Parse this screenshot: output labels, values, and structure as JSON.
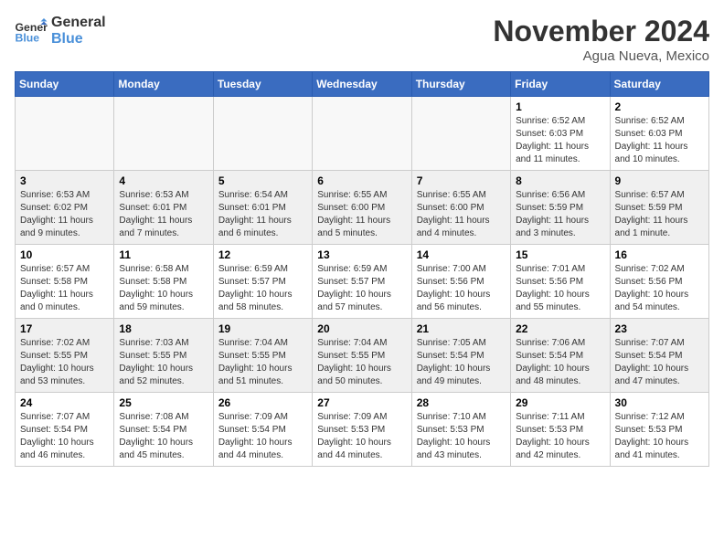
{
  "header": {
    "logo_line1": "General",
    "logo_line2": "Blue",
    "month": "November 2024",
    "location": "Agua Nueva, Mexico"
  },
  "weekdays": [
    "Sunday",
    "Monday",
    "Tuesday",
    "Wednesday",
    "Thursday",
    "Friday",
    "Saturday"
  ],
  "weeks": [
    [
      {
        "day": "",
        "info": ""
      },
      {
        "day": "",
        "info": ""
      },
      {
        "day": "",
        "info": ""
      },
      {
        "day": "",
        "info": ""
      },
      {
        "day": "",
        "info": ""
      },
      {
        "day": "1",
        "info": "Sunrise: 6:52 AM\nSunset: 6:03 PM\nDaylight: 11 hours\nand 11 minutes."
      },
      {
        "day": "2",
        "info": "Sunrise: 6:52 AM\nSunset: 6:03 PM\nDaylight: 11 hours\nand 10 minutes."
      }
    ],
    [
      {
        "day": "3",
        "info": "Sunrise: 6:53 AM\nSunset: 6:02 PM\nDaylight: 11 hours\nand 9 minutes."
      },
      {
        "day": "4",
        "info": "Sunrise: 6:53 AM\nSunset: 6:01 PM\nDaylight: 11 hours\nand 7 minutes."
      },
      {
        "day": "5",
        "info": "Sunrise: 6:54 AM\nSunset: 6:01 PM\nDaylight: 11 hours\nand 6 minutes."
      },
      {
        "day": "6",
        "info": "Sunrise: 6:55 AM\nSunset: 6:00 PM\nDaylight: 11 hours\nand 5 minutes."
      },
      {
        "day": "7",
        "info": "Sunrise: 6:55 AM\nSunset: 6:00 PM\nDaylight: 11 hours\nand 4 minutes."
      },
      {
        "day": "8",
        "info": "Sunrise: 6:56 AM\nSunset: 5:59 PM\nDaylight: 11 hours\nand 3 minutes."
      },
      {
        "day": "9",
        "info": "Sunrise: 6:57 AM\nSunset: 5:59 PM\nDaylight: 11 hours\nand 1 minute."
      }
    ],
    [
      {
        "day": "10",
        "info": "Sunrise: 6:57 AM\nSunset: 5:58 PM\nDaylight: 11 hours\nand 0 minutes."
      },
      {
        "day": "11",
        "info": "Sunrise: 6:58 AM\nSunset: 5:58 PM\nDaylight: 10 hours\nand 59 minutes."
      },
      {
        "day": "12",
        "info": "Sunrise: 6:59 AM\nSunset: 5:57 PM\nDaylight: 10 hours\nand 58 minutes."
      },
      {
        "day": "13",
        "info": "Sunrise: 6:59 AM\nSunset: 5:57 PM\nDaylight: 10 hours\nand 57 minutes."
      },
      {
        "day": "14",
        "info": "Sunrise: 7:00 AM\nSunset: 5:56 PM\nDaylight: 10 hours\nand 56 minutes."
      },
      {
        "day": "15",
        "info": "Sunrise: 7:01 AM\nSunset: 5:56 PM\nDaylight: 10 hours\nand 55 minutes."
      },
      {
        "day": "16",
        "info": "Sunrise: 7:02 AM\nSunset: 5:56 PM\nDaylight: 10 hours\nand 54 minutes."
      }
    ],
    [
      {
        "day": "17",
        "info": "Sunrise: 7:02 AM\nSunset: 5:55 PM\nDaylight: 10 hours\nand 53 minutes."
      },
      {
        "day": "18",
        "info": "Sunrise: 7:03 AM\nSunset: 5:55 PM\nDaylight: 10 hours\nand 52 minutes."
      },
      {
        "day": "19",
        "info": "Sunrise: 7:04 AM\nSunset: 5:55 PM\nDaylight: 10 hours\nand 51 minutes."
      },
      {
        "day": "20",
        "info": "Sunrise: 7:04 AM\nSunset: 5:55 PM\nDaylight: 10 hours\nand 50 minutes."
      },
      {
        "day": "21",
        "info": "Sunrise: 7:05 AM\nSunset: 5:54 PM\nDaylight: 10 hours\nand 49 minutes."
      },
      {
        "day": "22",
        "info": "Sunrise: 7:06 AM\nSunset: 5:54 PM\nDaylight: 10 hours\nand 48 minutes."
      },
      {
        "day": "23",
        "info": "Sunrise: 7:07 AM\nSunset: 5:54 PM\nDaylight: 10 hours\nand 47 minutes."
      }
    ],
    [
      {
        "day": "24",
        "info": "Sunrise: 7:07 AM\nSunset: 5:54 PM\nDaylight: 10 hours\nand 46 minutes."
      },
      {
        "day": "25",
        "info": "Sunrise: 7:08 AM\nSunset: 5:54 PM\nDaylight: 10 hours\nand 45 minutes."
      },
      {
        "day": "26",
        "info": "Sunrise: 7:09 AM\nSunset: 5:54 PM\nDaylight: 10 hours\nand 44 minutes."
      },
      {
        "day": "27",
        "info": "Sunrise: 7:09 AM\nSunset: 5:53 PM\nDaylight: 10 hours\nand 44 minutes."
      },
      {
        "day": "28",
        "info": "Sunrise: 7:10 AM\nSunset: 5:53 PM\nDaylight: 10 hours\nand 43 minutes."
      },
      {
        "day": "29",
        "info": "Sunrise: 7:11 AM\nSunset: 5:53 PM\nDaylight: 10 hours\nand 42 minutes."
      },
      {
        "day": "30",
        "info": "Sunrise: 7:12 AM\nSunset: 5:53 PM\nDaylight: 10 hours\nand 41 minutes."
      }
    ]
  ]
}
